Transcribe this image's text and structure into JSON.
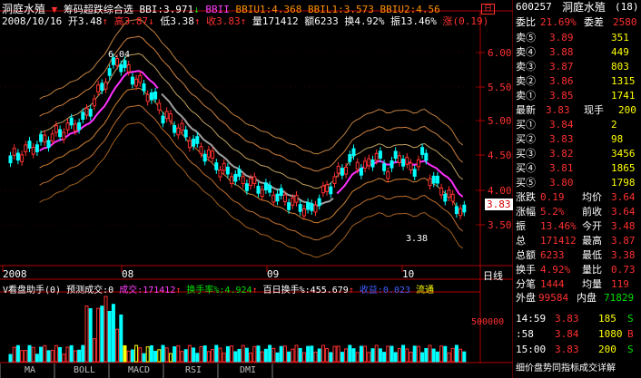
{
  "title": {
    "name": "洞庭水殖",
    "indicator": "筹码超跌综合选",
    "bbi": "BBI:3.971",
    "bbii": "BBII",
    "bbiu1": "BBIU1:4.368",
    "bbil1": "BBIL1:3.573",
    "bbiu2": "BBIU2:4.56"
  },
  "info": {
    "date": "2008/10/16",
    "open_label": "开",
    "open": "3.48",
    "high_label": "高",
    "high": "3.87",
    "low_label": "低",
    "low": "3.38",
    "close_label": "收",
    "close": "3.83",
    "vol_label": "量",
    "vol": "171412",
    "amt_label": "额",
    "amt": "6233",
    "turn_label": "换",
    "turn": "4.92%",
    "amp_label": "振",
    "amp": "13.46%",
    "chg_label": "涨",
    "chg": "(0.19)"
  },
  "axis": {
    "y_labels": [
      "6.00",
      "5.50",
      "5.00",
      "4.50",
      "4.00",
      "3.50"
    ],
    "current_price": "3.83",
    "x_labels": [
      "2008",
      "08",
      "09",
      "10"
    ],
    "x_tag": "日线",
    "peak_label": "6.04",
    "low_label": "3.38",
    "vol_tick": "500000"
  },
  "volume_bar": {
    "prefix": "V看盘助手(0)",
    "predict": "预测成交:0",
    "vol": "成交:171412",
    "turnover": "换手率%:4.924",
    "hundred": "百日换手%:455.679",
    "profit": "收益:0.023",
    "flow": "流通"
  },
  "tabs": [
    "MA",
    "BOLL",
    "MACD",
    "RSI",
    "DMI"
  ],
  "right": {
    "code": "600257",
    "name": "洞庭水殖",
    "num": "(18)",
    "wei_label": "委比",
    "wei": "21.69%",
    "cha_label": "委差",
    "cha": "2580",
    "sells": [
      {
        "label": "卖⑤",
        "price": "3.89",
        "vol": "351"
      },
      {
        "label": "卖④",
        "price": "3.88",
        "vol": "449"
      },
      {
        "label": "卖③",
        "price": "3.87",
        "vol": "803"
      },
      {
        "label": "卖②",
        "price": "3.86",
        "vol": "1315"
      },
      {
        "label": "卖①",
        "price": "3.85",
        "vol": "1741"
      }
    ],
    "last_label": "最新",
    "last": "3.83",
    "hand_label": "现手",
    "hand": "200",
    "buys": [
      {
        "label": "买①",
        "price": "3.84",
        "vol": "2"
      },
      {
        "label": "买②",
        "price": "3.83",
        "vol": "98"
      },
      {
        "label": "买③",
        "price": "3.82",
        "vol": "3456"
      },
      {
        "label": "买④",
        "price": "3.81",
        "vol": "1865"
      },
      {
        "label": "买⑤",
        "price": "3.80",
        "vol": "1798"
      }
    ],
    "stats": [
      {
        "l1": "涨跌",
        "v1": "0.19",
        "l2": "均价",
        "v2": "3.64"
      },
      {
        "l1": "涨幅",
        "v1": "5.2%",
        "l2": "前收",
        "v2": "3.64"
      },
      {
        "l1": "振",
        "v1": "13.46%",
        "l2": "今开",
        "v2": "3.48"
      },
      {
        "l1": "总",
        "v1": "171412",
        "l2": "最高",
        "v2": "3.87"
      },
      {
        "l1": "总额",
        "v1": "6233",
        "l2": "最低",
        "v2": "3.38"
      },
      {
        "l1": "换手",
        "v1": "4.92%",
        "l2": "量比",
        "v2": "0.73"
      },
      {
        "l1": "分笔",
        "v1": "1444",
        "l2": "均量",
        "v2": "119"
      }
    ],
    "outer_label": "外盘",
    "outer": "99584",
    "inner_label": "内盘",
    "inner": "71829",
    "ticks": [
      {
        "time": "14:59",
        "price": "3.83",
        "vol": "185",
        "dir": "S"
      },
      {
        ":": "",
        "time": ":58",
        "price": "3.84",
        "vol": "1080",
        "dir": "B"
      },
      {
        "time": "15:00",
        "price": "3.83",
        "vol": "200",
        "dir": "S"
      }
    ],
    "bottom": "细价盘势同指标成交详解"
  }
}
